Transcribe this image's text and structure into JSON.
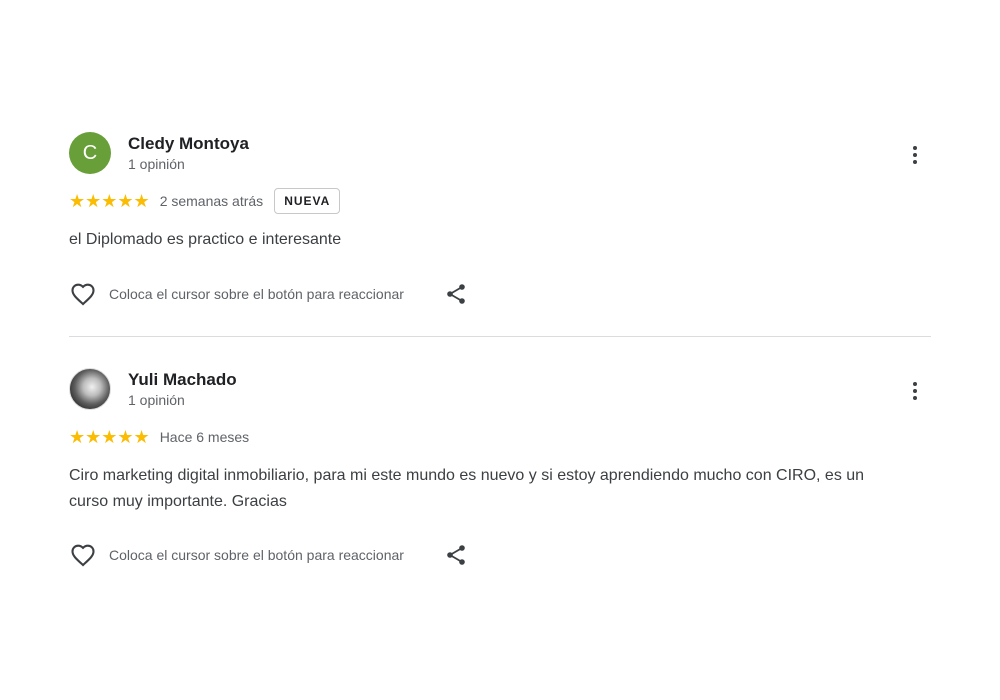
{
  "reviews": [
    {
      "name": "Cledy Montoya",
      "avatar_letter": "C",
      "avatar_color": "#689f38",
      "count": "1 opinión",
      "stars": "★★★★★",
      "rating": 5,
      "time": "2 semanas atrás",
      "badge": "NUEVA",
      "text": "el Diplomado es practico e interesante",
      "react_label": "Coloca el cursor sobre el botón para reaccionar"
    },
    {
      "name": "Yuli Machado",
      "count": "1 opinión",
      "stars": "★★★★★",
      "rating": 5,
      "time": "Hace 6 meses",
      "text": "Ciro marketing digital inmobiliario, para mi este mundo es nuevo y si estoy aprendiendo mucho con CIRO, es un curso muy importante. Gracias",
      "react_label": "Coloca el cursor sobre el botón para reaccionar"
    }
  ],
  "colors": {
    "star": "#fbbc04",
    "divider": "#dadce0"
  }
}
